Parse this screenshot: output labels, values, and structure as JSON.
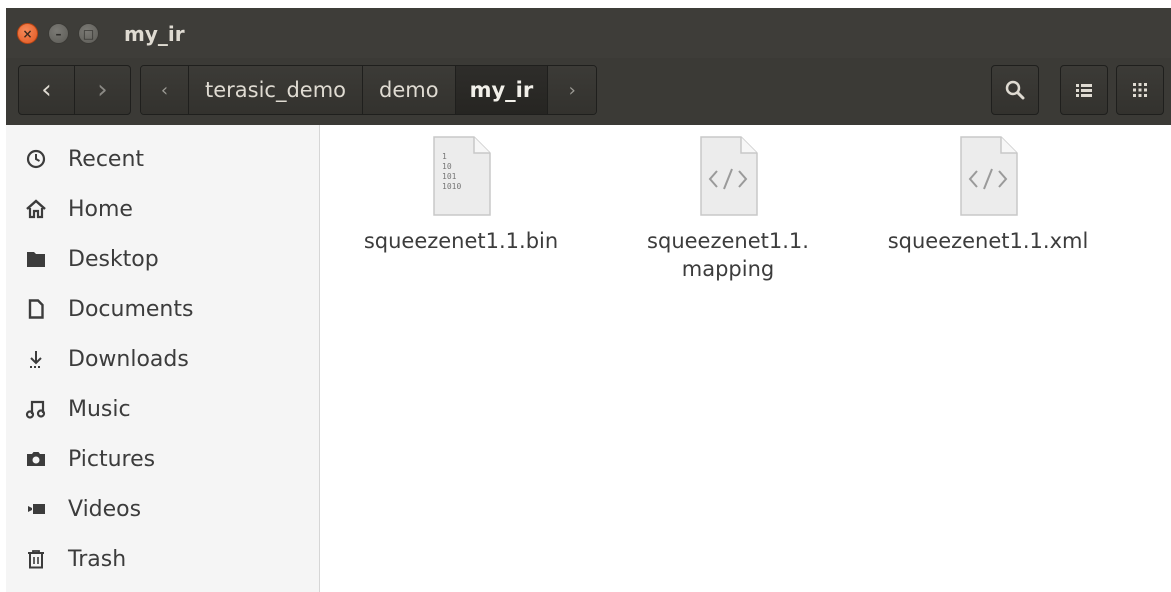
{
  "window": {
    "title": "my_ir",
    "close_glyph": "×",
    "min_glyph": "–",
    "max_glyph": "□"
  },
  "toolbar": {
    "back_glyph": "‹",
    "forward_glyph": "›",
    "path_left_glyph": "‹",
    "path_right_glyph": "›",
    "breadcrumbs": [
      "terasic_demo",
      "demo",
      "my_ir"
    ],
    "search_icon": "search-icon",
    "list_view_icon": "list-view-icon",
    "grid_view_icon": "grid-view-icon"
  },
  "sidebar": {
    "items": [
      {
        "label": "Recent",
        "icon": "clock-icon"
      },
      {
        "label": "Home",
        "icon": "home-icon"
      },
      {
        "label": "Desktop",
        "icon": "folder-icon"
      },
      {
        "label": "Documents",
        "icon": "document-icon"
      },
      {
        "label": "Downloads",
        "icon": "download-icon"
      },
      {
        "label": "Music",
        "icon": "music-icon"
      },
      {
        "label": "Pictures",
        "icon": "camera-icon"
      },
      {
        "label": "Videos",
        "icon": "video-icon"
      },
      {
        "label": "Trash",
        "icon": "trash-icon"
      }
    ]
  },
  "files": [
    {
      "name": "squeezenet1.1.bin",
      "icon": "binary-file-icon",
      "binary_lines": [
        "1",
        "10",
        "101",
        "1010"
      ]
    },
    {
      "name_line1": "squeezenet1.1.",
      "name_line2": "mapping",
      "icon": "code-file-icon"
    },
    {
      "name": "squeezenet1.1.xml",
      "icon": "code-file-icon"
    }
  ],
  "colors": {
    "titlebar": "#3e3d39",
    "close_button": "#e25720",
    "sidebar_bg": "#f5f5f5"
  }
}
